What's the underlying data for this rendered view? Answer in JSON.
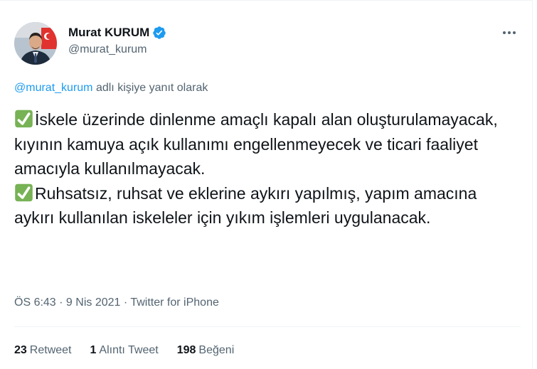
{
  "author": {
    "name": "Murat KURUM",
    "handle": "@murat_kurum",
    "verified": true
  },
  "reply_context": {
    "mention": "@murat_kurum",
    "suffix": " adlı kişiye yanıt olarak"
  },
  "tweet": {
    "paragraphs": [
      "İskele üzerinde dinlenme amaçlı kapalı alan oluşturulamayacak, kıyının kamuya açık kullanımı engellenmeyecek ve ticari faaliyet amacıyla kullanılmayacak.",
      "Ruhsatsız, ruhsat ve eklerine aykırı yapılmış, yapım amacına aykırı kullanılan iskeleler için yıkım işlemleri uygulanacak."
    ],
    "emoji": "check-mark-button-icon"
  },
  "meta": {
    "time": "ÖS 6:43",
    "separator": " · ",
    "date": "9 Nis 2021",
    "source": "Twitter for iPhone"
  },
  "stats": {
    "retweets_count": "23",
    "retweets_label": "Retweet",
    "quotes_count": "1",
    "quotes_label": "Alıntı Tweet",
    "likes_count": "198",
    "likes_label": "Beğeni"
  },
  "colors": {
    "link": "#1d9bf0",
    "secondary_text": "#536471",
    "primary_text": "#0f1419",
    "check_green": "#77b255"
  }
}
